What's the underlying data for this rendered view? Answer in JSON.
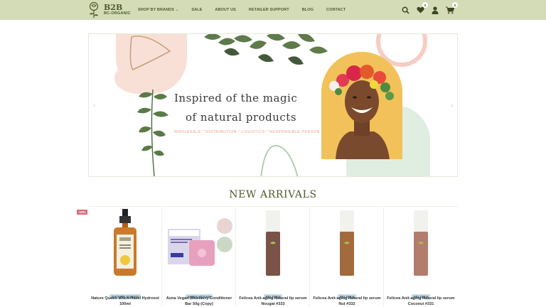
{
  "header": {
    "logo_title": "B2B",
    "logo_subtitle": "BC-ORGANIC",
    "nav": [
      {
        "label": "SHOP BY BRANDS",
        "has_dropdown": true
      },
      {
        "label": "SALE"
      },
      {
        "label": "ABOUT US"
      },
      {
        "label": "RETAILER SUPPORT"
      },
      {
        "label": "BLOG"
      },
      {
        "label": "CONTACT"
      }
    ],
    "icons": {
      "search": "search-icon",
      "wishlist": "heart-icon",
      "wishlist_count": "0",
      "account": "user-icon",
      "cart": "cart-icon",
      "cart_count": "0"
    },
    "colors": {
      "bar": "#d3dcb7",
      "accent": "#4d5a2a"
    }
  },
  "banner": {
    "title_line1": "Inspired of the magic",
    "title_line2": "of natural products",
    "subtitle": "WHOLESALE \" DISTRIBUTION \" LOGISTICS \" RESPONSIBLE PERSON",
    "prev_arrow": "‹",
    "next_arrow": "›"
  },
  "new_arrivals": {
    "title": "NEW ARRIVALS",
    "sale_badge": "-10%",
    "products": [
      {
        "brand": "NATURE QUEEN",
        "name": "Nature Queen Witch-Hazel Hydrosol 100ml"
      },
      {
        "brand": "AUNA-VEGAN",
        "name": "Auna Vegan Blueberry Conditioner Bar 50g (Copy)"
      },
      {
        "brand": "FELICEA",
        "name": "Felicea Anit-aging Natural lip serum Nougat #333"
      },
      {
        "brand": "FELICEA",
        "name": "Felicea Anit-aging Natural lip serum Nut #332"
      },
      {
        "brand": "FELICEA",
        "name": "Felicea Anit-aging Natural lip serum Coconut #331"
      }
    ]
  }
}
